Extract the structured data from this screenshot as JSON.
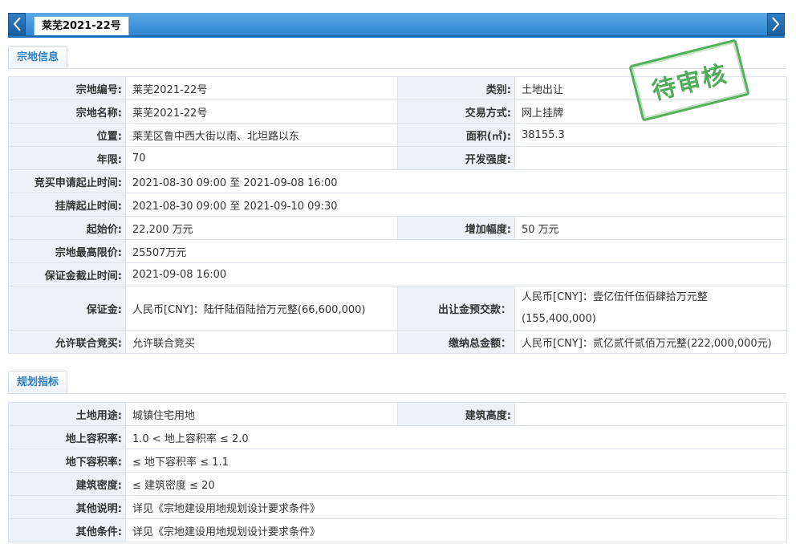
{
  "tab": {
    "title": "莱芜2021-22号"
  },
  "stamp": {
    "text": "待审核",
    "color": "#3ea34a"
  },
  "section1": {
    "title": "宗地信息",
    "rows": {
      "parcel_no": {
        "label": "宗地编号:",
        "value": "莱芜2021-22号"
      },
      "category": {
        "label": "类别:",
        "value": "土地出让"
      },
      "parcel_name": {
        "label": "宗地名称:",
        "value": "莱芜2021-22号"
      },
      "trade_method": {
        "label": "交易方式:",
        "value": "网上挂牌"
      },
      "location": {
        "label": "位置:",
        "value": "莱芜区鲁中西大街以南、北坦路以东"
      },
      "area": {
        "label": "面积(㎡):",
        "value": "38155.3"
      },
      "term": {
        "label": "年限:",
        "value": "70"
      },
      "dev_intensity": {
        "label": "开发强度:",
        "value": ""
      },
      "bid_apply_period": {
        "label": "竞买申请起止时间:",
        "value": "2021-08-30 09:00 至 2021-09-08 16:00"
      },
      "listing_period": {
        "label": "挂牌起止时间:",
        "value": "2021-08-30 09:00 至 2021-09-10 09:30"
      },
      "start_price": {
        "label": "起始价:",
        "value": "22,200 万元"
      },
      "increment": {
        "label": "增加幅度:",
        "value": "50 万元"
      },
      "max_price": {
        "label": "宗地最高限价:",
        "value": "25507万元"
      },
      "deposit_deadline": {
        "label": "保证金截止时间:",
        "value": "2021-09-08 16:00"
      },
      "deposit": {
        "label": "保证金:",
        "value": "人民币[CNY]：陆仟陆佰陆拾万元整(66,600,000)"
      },
      "prepay": {
        "label": "出让金预交款：",
        "value_line1": "人民币[CNY]：壹亿伍仟伍佰肆拾万元整",
        "value_line2": "(155,400,000)"
      },
      "joint_bid": {
        "label": "允许联合竞买:",
        "value": "允许联合竞买"
      },
      "total_payment": {
        "label": "缴纳总金额：",
        "value": "人民币[CNY]：贰亿贰仟贰佰万元整(222,000,000元)"
      }
    }
  },
  "section2": {
    "title": "规划指标",
    "rows": {
      "land_use": {
        "label": "土地用途:",
        "value": "城镇住宅用地"
      },
      "building_height": {
        "label": "建筑高度:",
        "value": ""
      },
      "far_above": {
        "label": "地上容积率:",
        "value": "1.0 < 地上容积率 ≤ 2.0"
      },
      "far_below": {
        "label": "地下容积率:",
        "value": "≤ 地下容积率 ≤ 1.1"
      },
      "density": {
        "label": "建筑密度:",
        "value": "≤ 建筑密度 ≤ 20"
      },
      "other_desc": {
        "label": "其他说明:",
        "value": "详见《宗地建设用地规划设计要求条件》"
      },
      "other_cond": {
        "label": "其他条件:",
        "value": "详见《宗地建设用地规划设计要求条件》"
      }
    }
  }
}
